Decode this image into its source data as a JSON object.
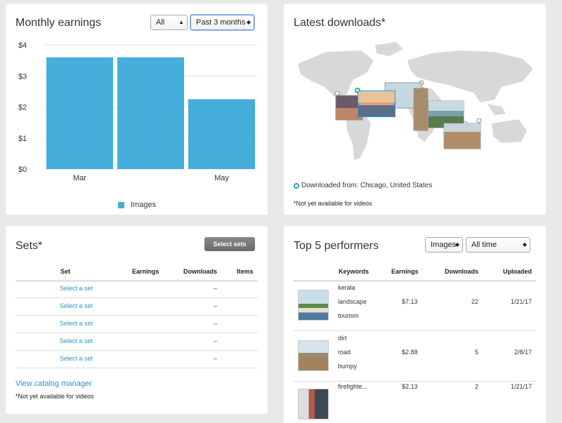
{
  "monthly_earnings": {
    "title": "Monthly earnings",
    "filter_type": "All",
    "filter_period": "Past 3 months",
    "legend": "Images",
    "colors": {
      "bar": "#45aedb"
    }
  },
  "chart_data": {
    "type": "bar",
    "categories": [
      "Mar",
      "",
      "May"
    ],
    "series": [
      {
        "name": "Images",
        "values": [
          3.6,
          3.6,
          2.25
        ]
      }
    ],
    "yticks": [
      "$4",
      "$3",
      "$2",
      "$1",
      "$0"
    ],
    "ylim": [
      0,
      4
    ],
    "grid": true,
    "legend_position": "bottom"
  },
  "latest_downloads": {
    "title": "Latest downloads*",
    "downloaded_from": "Downloaded from: Chicago, United States",
    "note": "*Not yet available for videos"
  },
  "sets": {
    "title": "Sets*",
    "select_button": "Select sets",
    "columns": [
      "Set",
      "Earnings",
      "Downloads",
      "Items"
    ],
    "rows": [
      {
        "set": "Select a set",
        "downloads": "–"
      },
      {
        "set": "Select a set",
        "downloads": "–"
      },
      {
        "set": "Select a set",
        "downloads": "–"
      },
      {
        "set": "Select a set",
        "downloads": "–"
      },
      {
        "set": "Select a set",
        "downloads": "–"
      }
    ],
    "catalog_link": "View catalog manager",
    "note": "*Not yet available for videos"
  },
  "top_performers": {
    "title": "Top 5 performers",
    "filter_type": "Images",
    "filter_period": "All time",
    "columns": [
      "Keywords",
      "Earnings",
      "Downloads",
      "Uploaded"
    ],
    "rows": [
      {
        "keywords": [
          "kerala",
          "landscape",
          "tourism"
        ],
        "earnings": "$7.13",
        "downloads": "22",
        "uploaded": "1/21/17",
        "thumb": "backwater-boat-photo"
      },
      {
        "keywords": [
          "dirt",
          "road",
          "bumpy"
        ],
        "earnings": "$2.88",
        "downloads": "5",
        "uploaded": "2/8/17",
        "thumb": "dirt-road-photo"
      },
      {
        "keywords": [
          "firefighte..."
        ],
        "earnings": "$2.13",
        "downloads": "2",
        "uploaded": "1/21/17",
        "thumb": "firefighter-photo"
      }
    ]
  }
}
